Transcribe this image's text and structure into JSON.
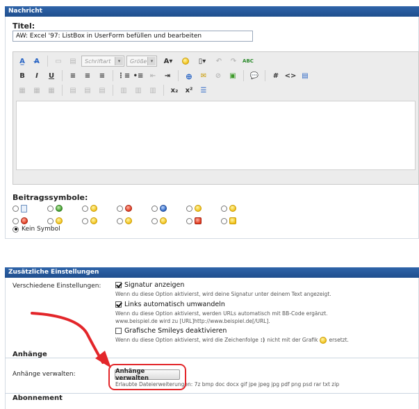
{
  "nachricht": {
    "header": "Nachricht",
    "title_label": "Titel:",
    "title_value": "AW: Excel '97: ListBox in UserForm befüllen und bearbeiten",
    "toolbar": {
      "font_select": "Schriftart",
      "size_select": "Größe",
      "font_color": "A",
      "bold": "B",
      "italic": "I",
      "underline": "U",
      "hash": "#",
      "code": "<>",
      "sub": "x₂",
      "sup": "x²"
    },
    "smilies_label": "Beitragssymbole:",
    "no_symbol": "Kein Symbol"
  },
  "settings": {
    "header": "Zusätzliche Einstellungen",
    "misc_label": "Verschiedene Einstellungen:",
    "options": [
      {
        "label": "Signatur anzeigen",
        "checked": true,
        "desc": "Wenn du diese Option aktivierst, wird deine Signatur unter deinem Text angezeigt."
      },
      {
        "label": "Links automatisch umwandeln",
        "checked": true,
        "desc1": "Wenn du diese Option aktivierst, werden URLs automatisch mit BB-Code ergänzt.",
        "desc2": "www.beispiel.de wird zu [URL]http://www.beispiel.de[/URL]."
      },
      {
        "label": "Grafische Smileys deaktivieren",
        "checked": false,
        "desc_a": "Wenn du diese Option aktivierst, wird die Zeichenfolge",
        "desc_code": ":)",
        "desc_b": "nicht mit der Grafik",
        "desc_c": "ersetzt."
      }
    ],
    "attachments_heading": "Anhänge",
    "attachments_label": "Anhänge verwalten:",
    "attachments_button": "Anhänge verwalten",
    "allowed_ext": "Erlaubte Dateierweiterungen: 7z bmp doc docx gif jpe jpeg jpg pdf png psd rar txt zip",
    "subscription_heading": "Abonnement"
  },
  "colors": {
    "bar": "#2f64a9",
    "highlight": "#e3262a",
    "arrow": "#e3262a"
  }
}
